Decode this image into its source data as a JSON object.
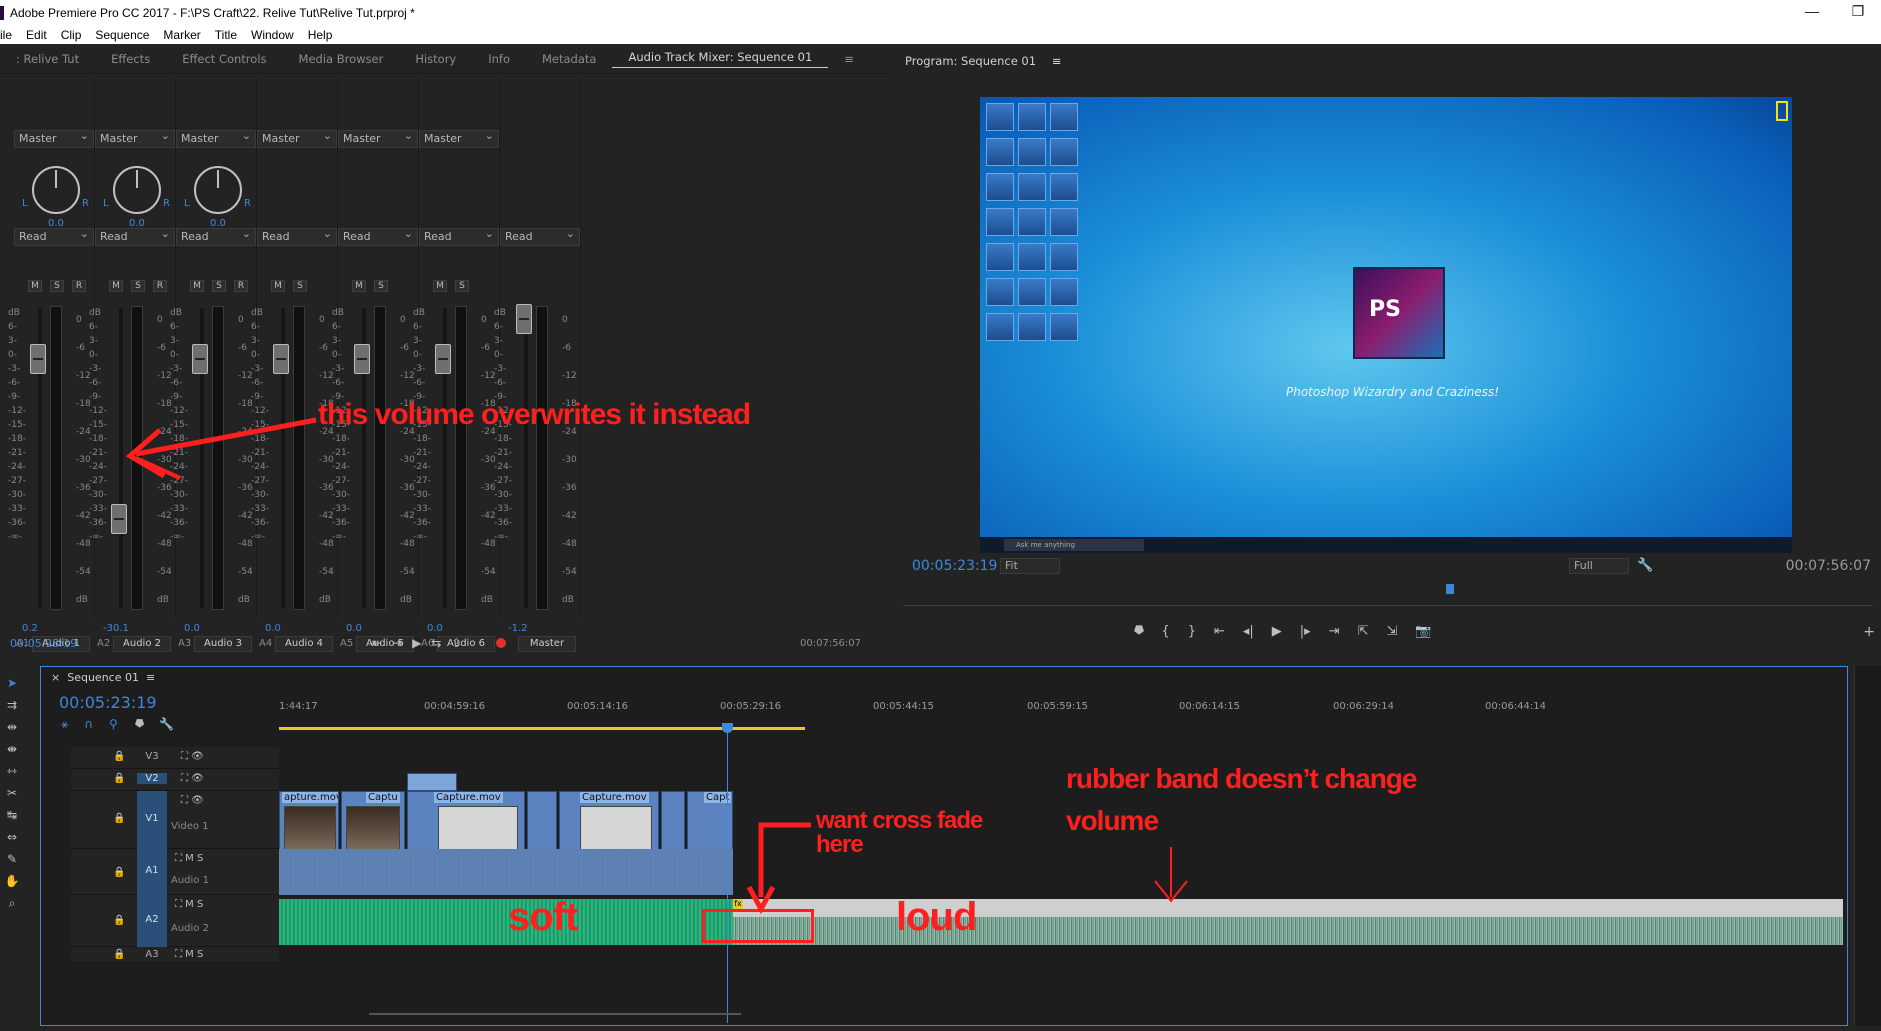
{
  "window": {
    "title": "Adobe Premiere Pro CC 2017 - F:\\PS Craft\\22. Relive Tut\\Relive Tut.prproj *",
    "controls": [
      "—",
      "❐"
    ]
  },
  "menu": [
    "ile",
    "Edit",
    "Clip",
    "Sequence",
    "Marker",
    "Title",
    "Window",
    "Help"
  ],
  "panel_tabs": [
    ": Relive Tut",
    "Effects",
    "Effect Controls",
    "Media Browser",
    "History",
    "Info",
    "Metadata",
    "Audio Track Mixer: Sequence 01"
  ],
  "mixer": {
    "channels": [
      {
        "id": "A1",
        "name": "Audio 1",
        "output": "Master",
        "mode": "Read",
        "pan": "0.0",
        "value": "0.2",
        "buttons": [
          "M",
          "S",
          "R"
        ]
      },
      {
        "id": "A2",
        "name": "Audio 2",
        "output": "Master",
        "mode": "Read",
        "pan": "0.0",
        "value": "-30.1",
        "buttons": [
          "M",
          "S",
          "R"
        ]
      },
      {
        "id": "A3",
        "name": "Audio 3",
        "output": "Master",
        "mode": "Read",
        "pan": "0.0",
        "value": "0.0",
        "buttons": [
          "M",
          "S",
          "R"
        ]
      },
      {
        "id": "A4",
        "name": "Audio 4",
        "output": "Master",
        "mode": "Read",
        "pan": "",
        "value": "0.0",
        "buttons": [
          "M",
          "S"
        ]
      },
      {
        "id": "A5",
        "name": "Audio 5",
        "output": "Master",
        "mode": "Read",
        "pan": "",
        "value": "0.0",
        "buttons": [
          "M",
          "S"
        ]
      },
      {
        "id": "A6",
        "name": "Audio 6",
        "output": "Master",
        "mode": "Read",
        "pan": "",
        "value": "0.0",
        "buttons": [
          "M",
          "S"
        ]
      },
      {
        "id": "",
        "name": "Master",
        "output": "",
        "mode": "Read",
        "pan": "",
        "value": "-1.2",
        "buttons": []
      }
    ],
    "scale_left": [
      "dB",
      "6-",
      "3-",
      "0-",
      "-3-",
      "-6-",
      "-9-",
      "-12-",
      "-15-",
      "-18-",
      "-21-",
      "-24-",
      "-27-",
      "-30-",
      "-33-",
      "-36-",
      "-∞-"
    ],
    "scale_right": [
      "0",
      "-6",
      "-12",
      "-18",
      "-24",
      "-30",
      "-36",
      "-42",
      "-48",
      "-54",
      "dB"
    ],
    "time": "00:05:23:19",
    "duration": "00:07:56:07"
  },
  "program": {
    "title": "Program: Sequence 01",
    "tagline": "Photoshop Wizardry and Craziness!",
    "logo_text": "PS",
    "search_placeholder": "Ask me anything",
    "timecode": "00:05:23:19",
    "fit": "Fit",
    "quality": "Full",
    "duration": "00:07:56:07"
  },
  "timeline": {
    "sequence_tab": "Sequence 01",
    "timecode": "00:05:23:19",
    "ruler": [
      "1:44:17",
      "00:04:59:16",
      "00:05:14:16",
      "00:05:29:16",
      "00:05:44:15",
      "00:05:59:15",
      "00:06:14:15",
      "00:06:29:14",
      "00:06:44:14"
    ],
    "tracks": [
      {
        "id": "V3",
        "name": ""
      },
      {
        "id": "V2",
        "name": ""
      },
      {
        "id": "V1",
        "name": "Video 1"
      },
      {
        "id": "A1",
        "name": "Audio 1"
      },
      {
        "id": "A2",
        "name": "Audio 2"
      },
      {
        "id": "A3",
        "name": ""
      }
    ],
    "clips": [
      "apture.mov",
      "Captu",
      "Capture.mov",
      "Capture.mov",
      "Capt"
    ]
  },
  "annotations": {
    "overwrite": "this volume overwrites it instead",
    "crossfade1": "want cross fade",
    "crossfade2": "here",
    "rubber1": "rubber band doesn’t change",
    "rubber2": "volume",
    "soft": "soft",
    "loud": "loud"
  },
  "colors": {
    "accent": "#3f87d8",
    "annotation": "#ff1f1f",
    "audio_green": "#2cc58b",
    "yellow_bar": "#e1cd25"
  }
}
